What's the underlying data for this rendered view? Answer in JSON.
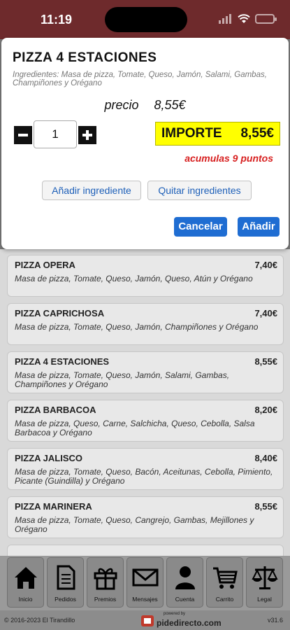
{
  "status_bar": {
    "time": "11:19"
  },
  "modal": {
    "title": "PIZZA 4 ESTACIONES",
    "ingredients": "Ingredientes: Masa de pizza, Tomate, Queso, Jamón, Salami, Gambas, Champiñones y Orégano",
    "price_label": "precio",
    "price_value": "8,55€",
    "quantity": "1",
    "importe_label": "IMPORTE",
    "importe_value": "8,55€",
    "puntos": "acumulas 9 puntos",
    "add_ingredient": "Añadir ingrediente",
    "remove_ingredients": "Quitar ingredientes",
    "cancel": "Cancelar",
    "add": "Añadir"
  },
  "menu_items": [
    {
      "name": "PIZZA OPERA",
      "price": "7,40€",
      "desc": "Masa de pizza, Tomate, Queso, Jamón, Queso, Atún y Orégano"
    },
    {
      "name": "PIZZA CAPRICHOSA",
      "price": "7,40€",
      "desc": "Masa de pizza, Tomate, Queso, Jamón, Champiñones y Orégano"
    },
    {
      "name": "PIZZA 4 ESTACIONES",
      "price": "8,55€",
      "desc": "Masa de pizza, Tomate, Queso, Jamón, Salami, Gambas, Champiñones y Orégano"
    },
    {
      "name": "PIZZA BARBACOA",
      "price": "8,20€",
      "desc": "Masa de pizza, Queso, Carne, Salchicha, Queso, Cebolla, Salsa Barbacoa y Orégano"
    },
    {
      "name": "PIZZA JALISCO",
      "price": "8,40€",
      "desc": "Masa de pizza, Tomate, Queso, Bacón, Aceitunas, Cebolla, Pimiento, Picante (Guindilla) y Orégano"
    },
    {
      "name": "PIZZA MARINERA",
      "price": "8,55€",
      "desc": "Masa de pizza, Tomate, Queso, Cangrejo, Gambas, Mejillones y Orégano"
    }
  ],
  "nav": [
    {
      "label": "Inicio",
      "icon": "home-icon"
    },
    {
      "label": "Pedidos",
      "icon": "document-icon"
    },
    {
      "label": "Premios",
      "icon": "gift-icon"
    },
    {
      "label": "Mensajes",
      "icon": "envelope-icon"
    },
    {
      "label": "Cuenta",
      "icon": "user-icon"
    },
    {
      "label": "Carrito",
      "icon": "cart-icon"
    },
    {
      "label": "Legal",
      "icon": "scales-icon"
    }
  ],
  "footer": {
    "copyright": "© 2016-2023 El Tirandillo",
    "powered_by": "powered by",
    "brand": "pidedirecto.com",
    "version": "v31.6"
  },
  "colors": {
    "header": "#6e2a2c",
    "accent_blue": "#1f6dd2",
    "importe_bg": "#ffff00",
    "puntos_red": "#d71f1f"
  }
}
